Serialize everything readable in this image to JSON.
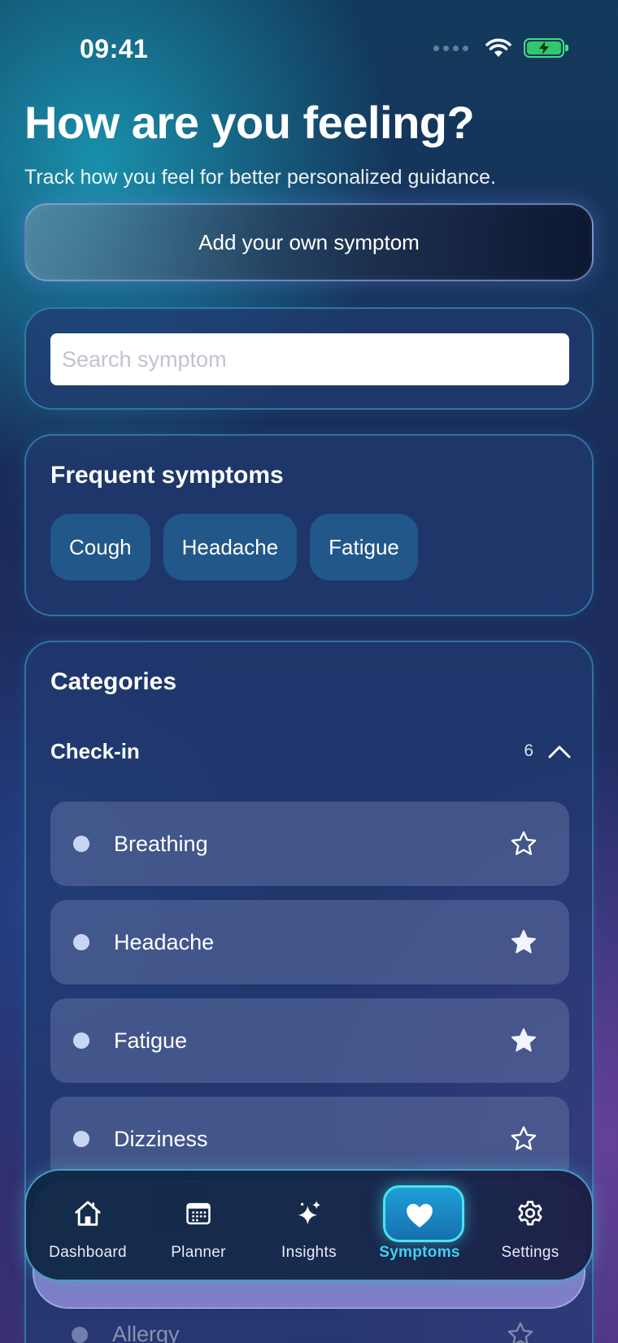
{
  "status_bar": {
    "time": "09:41"
  },
  "header": {
    "title": "How are you feeling?",
    "subtitle": "Track how you feel for better personalized guidance."
  },
  "add_symptom": {
    "label": "Add your own symptom"
  },
  "search": {
    "placeholder": "Search symptom",
    "value": ""
  },
  "frequent": {
    "heading": "Frequent symptoms",
    "chips": [
      "Cough",
      "Headache",
      "Fatigue"
    ]
  },
  "categories": {
    "heading": "Categories",
    "group": {
      "label": "Check-in",
      "count": "6",
      "expanded": true
    },
    "items": [
      {
        "label": "Breathing",
        "starred": false
      },
      {
        "label": "Headache",
        "starred": true
      },
      {
        "label": "Fatigue",
        "starred": true
      },
      {
        "label": "Dizziness",
        "starred": false
      },
      {
        "label": "Allergy",
        "starred": false
      }
    ]
  },
  "tab_bar": {
    "tabs": [
      {
        "label": "Dashboard",
        "icon": "home-icon"
      },
      {
        "label": "Planner",
        "icon": "calendar-icon"
      },
      {
        "label": "Insights",
        "icon": "sparkles-icon"
      },
      {
        "label": "Symptoms",
        "icon": "heart-icon",
        "active": true
      },
      {
        "label": "Settings",
        "icon": "gear-icon"
      }
    ]
  },
  "colors": {
    "accent": "#3fd0f2",
    "chip_bg": "#22578a",
    "battery": "#34c76a"
  }
}
